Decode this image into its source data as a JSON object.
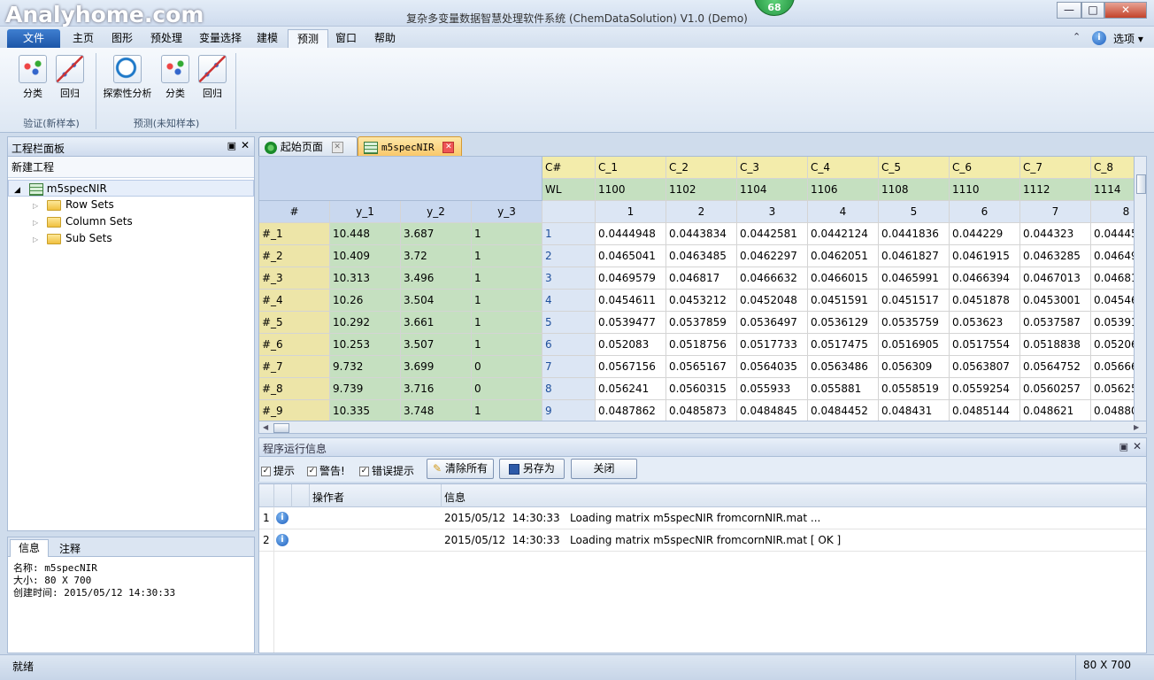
{
  "app": {
    "watermark": "Analyhome.com",
    "title": "复杂多变量数据智慧处理软件系统 (ChemDataSolution) V1.0 (Demo)",
    "badge_count": "68",
    "window_buttons": {
      "minimize": "—",
      "maximize": "□",
      "close": "✕"
    }
  },
  "menu": {
    "file": "文件",
    "tabs": [
      "主页",
      "图形",
      "预处理",
      "变量选择",
      "建模",
      "预测",
      "窗口",
      "帮助"
    ],
    "options": "选项"
  },
  "ribbon": {
    "groups": [
      {
        "label": "验证(新样本)",
        "buttons": [
          "分类",
          "回归"
        ]
      },
      {
        "label": "预测(未知样本)",
        "buttons": [
          "探索性分析",
          "分类",
          "回归"
        ]
      }
    ]
  },
  "left_panel": {
    "title": "工程栏面板",
    "new_project": "新建工程",
    "tree": {
      "root": "m5specNIR",
      "children": [
        "Row Sets",
        "Column Sets",
        "Sub Sets"
      ]
    }
  },
  "info_panel": {
    "tabs": [
      "信息",
      "注释"
    ],
    "lines": [
      "名称: m5specNIR",
      "大小: 80 X 700",
      "创建时间: 2015/05/12  14:30:33"
    ]
  },
  "doc_tabs": [
    "起始页面",
    "m5specNIR"
  ],
  "grid": {
    "row_header_title": "#",
    "y_headers": [
      "y_1",
      "y_2",
      "y_3"
    ],
    "cnum_label": "C#",
    "wl_label": "WL",
    "col_names": [
      "C_1",
      "C_2",
      "C_3",
      "C_4",
      "C_5",
      "C_6",
      "C_7",
      "C_8"
    ],
    "wavelengths": [
      "1100",
      "1102",
      "1104",
      "1106",
      "1108",
      "1110",
      "1112",
      "1114"
    ],
    "col_indices": [
      "1",
      "2",
      "3",
      "4",
      "5",
      "6",
      "7",
      "8"
    ],
    "rows": [
      {
        "id": "#_1",
        "y": [
          "10.448",
          "3.687",
          "1"
        ],
        "n": "1",
        "v": [
          "0.0444948",
          "0.0443834",
          "0.0442581",
          "0.0442124",
          "0.0441836",
          "0.044229",
          "0.044323",
          "0.04445"
        ]
      },
      {
        "id": "#_2",
        "y": [
          "10.409",
          "3.72",
          "1"
        ],
        "n": "2",
        "v": [
          "0.0465041",
          "0.0463485",
          "0.0462297",
          "0.0462051",
          "0.0461827",
          "0.0461915",
          "0.0463285",
          "0.04649"
        ]
      },
      {
        "id": "#_3",
        "y": [
          "10.313",
          "3.496",
          "1"
        ],
        "n": "3",
        "v": [
          "0.0469579",
          "0.046817",
          "0.0466632",
          "0.0466015",
          "0.0465991",
          "0.0466394",
          "0.0467013",
          "0.04681"
        ]
      },
      {
        "id": "#_4",
        "y": [
          "10.26",
          "3.504",
          "1"
        ],
        "n": "4",
        "v": [
          "0.0454611",
          "0.0453212",
          "0.0452048",
          "0.0451591",
          "0.0451517",
          "0.0451878",
          "0.0453001",
          "0.04546"
        ]
      },
      {
        "id": "#_5",
        "y": [
          "10.292",
          "3.661",
          "1"
        ],
        "n": "5",
        "v": [
          "0.0539477",
          "0.0537859",
          "0.0536497",
          "0.0536129",
          "0.0535759",
          "0.053623",
          "0.0537587",
          "0.05391"
        ]
      },
      {
        "id": "#_6",
        "y": [
          "10.253",
          "3.507",
          "1"
        ],
        "n": "6",
        "v": [
          "0.052083",
          "0.0518756",
          "0.0517733",
          "0.0517475",
          "0.0516905",
          "0.0517554",
          "0.0518838",
          "0.05206"
        ]
      },
      {
        "id": "#_7",
        "y": [
          "9.732",
          "3.699",
          "0"
        ],
        "n": "7",
        "v": [
          "0.0567156",
          "0.0565167",
          "0.0564035",
          "0.0563486",
          "0.056309",
          "0.0563807",
          "0.0564752",
          "0.05666"
        ]
      },
      {
        "id": "#_8",
        "y": [
          "9.739",
          "3.716",
          "0"
        ],
        "n": "8",
        "v": [
          "0.056241",
          "0.0560315",
          "0.055933",
          "0.055881",
          "0.0558519",
          "0.0559254",
          "0.0560257",
          "0.05625"
        ]
      },
      {
        "id": "#_9",
        "y": [
          "10.335",
          "3.748",
          "1"
        ],
        "n": "9",
        "v": [
          "0.0487862",
          "0.0485873",
          "0.0484845",
          "0.0484452",
          "0.048431",
          "0.0485144",
          "0.048621",
          "0.04880"
        ]
      }
    ]
  },
  "log": {
    "title": "程序运行信息",
    "checks": [
      "提示",
      "警告!",
      "错误提示"
    ],
    "buttons": [
      "清除所有",
      "另存为",
      "关闭"
    ],
    "headers": [
      "操作者",
      "信息"
    ],
    "rows": [
      {
        "n": "1",
        "time": "2015/05/12  14:30:33",
        "msg": "Loading matrix m5specNIR fromcornNIR.mat ..."
      },
      {
        "n": "2",
        "time": "2015/05/12  14:30:33",
        "msg": "Loading matrix m5specNIR fromcornNIR.mat [ OK ]"
      }
    ]
  },
  "status": {
    "left": "就绪",
    "right": "80  X  700"
  },
  "colors": {
    "accent": "#1d56a8",
    "y_cols": "#c5e0c0",
    "id_col": "#ede5a8",
    "header_blue": "#c9d8ef",
    "colname_yellow": "#f3ecab"
  }
}
